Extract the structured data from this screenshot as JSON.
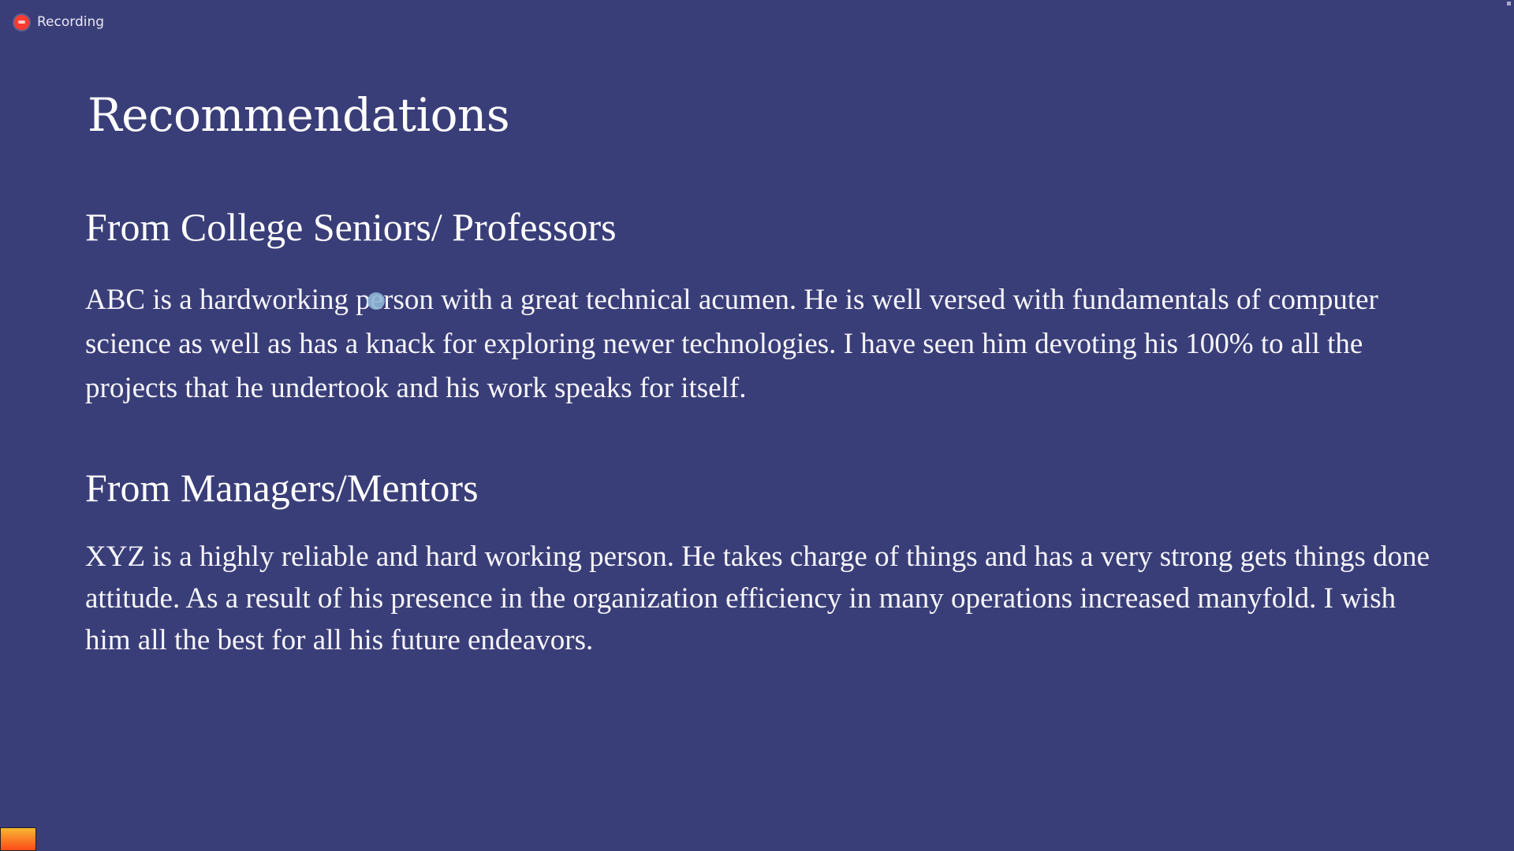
{
  "recording": {
    "label": "Recording",
    "icon": "record-icon",
    "color": "#ff3b30"
  },
  "slide": {
    "title": "Recommendations",
    "sections": [
      {
        "heading": "From College Seniors/ Professors",
        "body": "ABC is a hardworking person with a great technical acumen. He is well versed with fundamentals of computer science as well as has a knack for exploring newer technologies. I have seen him devoting his 100% to all the projects that he undertook and his work speaks for itself."
      },
      {
        "heading": "From Managers/Mentors",
        "body": "XYZ is a highly reliable and hard working person. He takes charge of things and has a very strong gets things done attitude. As a result of his presence in the organization efficiency in many operations increased manyfold. I wish him all the best for all his future endeavors."
      }
    ]
  },
  "colors": {
    "background": "#3a3e78",
    "text": "#ffffff",
    "cursor": "#8fb5d4"
  }
}
